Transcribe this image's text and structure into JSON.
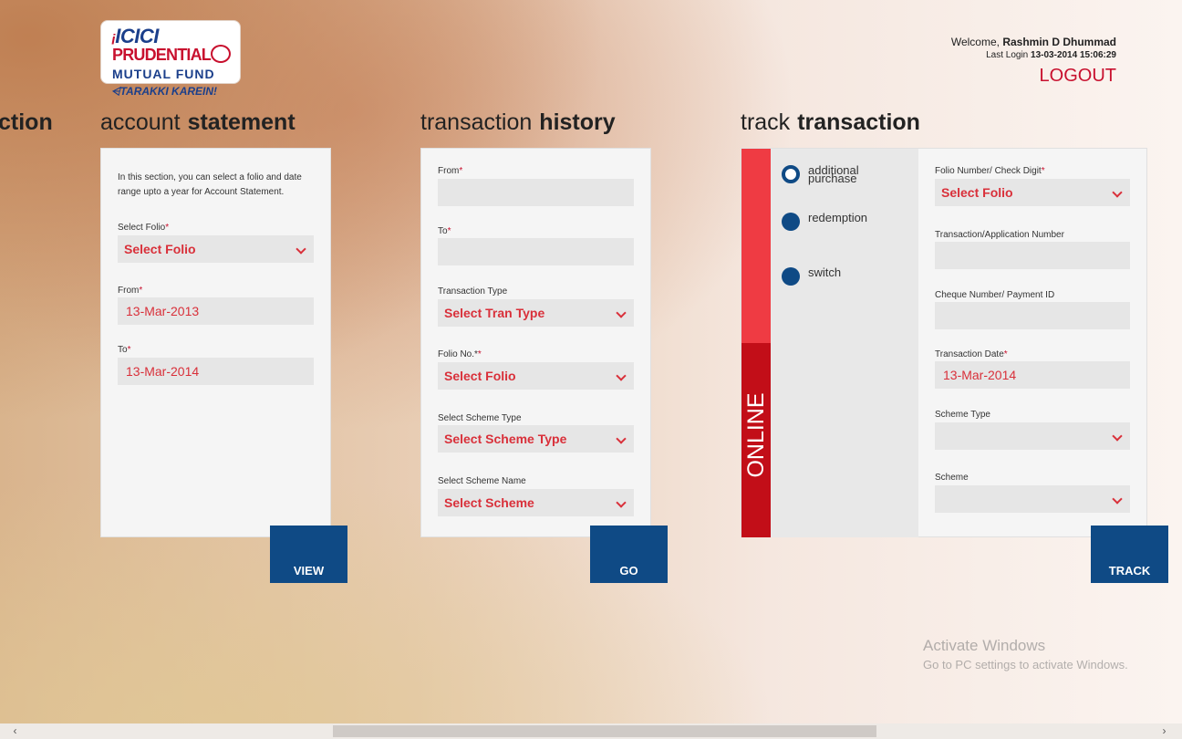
{
  "logo": {
    "line1": "ICICI",
    "line2": "PRUDENTIAL",
    "line3": "MUTUAL FUND",
    "tagline": "TARAKKI KAREIN!"
  },
  "header": {
    "welcome_prefix": "Welcome,",
    "user_name": "Rashmin D Dhummad",
    "last_login_prefix": "Last Login",
    "last_login_value": "13-03-2014 15:06:29",
    "logout_label": "LOGOUT"
  },
  "cut_section_title": "ction",
  "account_statement": {
    "title_light": "account",
    "title_bold": "statement",
    "description": "In this section, you can select a folio and date range upto a year for Account Statement.",
    "folio_label": "Select Folio",
    "folio_value": "Select Folio",
    "from_label": "From",
    "from_value": "13-Mar-2013",
    "to_label": "To",
    "to_value": "13-Mar-2014",
    "button_label": "VIEW"
  },
  "transaction_history": {
    "title_light": "transaction",
    "title_bold": "history",
    "from_label": "From",
    "to_label": "To",
    "tran_type_label": "Transaction Type",
    "tran_type_value": "Select Tran Type",
    "folio_label": "Folio No.*",
    "folio_value": "Select Folio",
    "scheme_type_label": "Select Scheme Type",
    "scheme_type_value": "Select Scheme Type",
    "scheme_name_label": "Select Scheme Name",
    "scheme_name_value": "Select Scheme",
    "button_label": "GO"
  },
  "track_transaction": {
    "title_light": "track",
    "title_bold": "transaction",
    "online_label": "ONLINE",
    "options": [
      {
        "label": "additional purchase",
        "selected": true
      },
      {
        "label": "redemption",
        "selected": false
      },
      {
        "label": "switch",
        "selected": false
      }
    ],
    "folio_label": "Folio Number/ Check Digit",
    "folio_value": "Select Folio",
    "app_number_label": "Transaction/Application Number",
    "cheque_label": "Cheque Number/ Payment ID",
    "date_label": "Transaction Date",
    "date_value": "13-Mar-2014",
    "scheme_type_label": "Scheme Type",
    "scheme_label": "Scheme",
    "button_label": "TRACK"
  },
  "watermark": {
    "title": "Activate Windows",
    "subtitle": "Go to PC settings to activate Windows."
  },
  "scrollbar": {
    "left_arrow": "‹",
    "right_arrow": "›"
  },
  "colors": {
    "accent_red": "#c8102e",
    "field_red": "#d9303a",
    "button_blue": "#0f4a85",
    "online_light": "#ef3b43",
    "online_dark": "#c20e18"
  }
}
